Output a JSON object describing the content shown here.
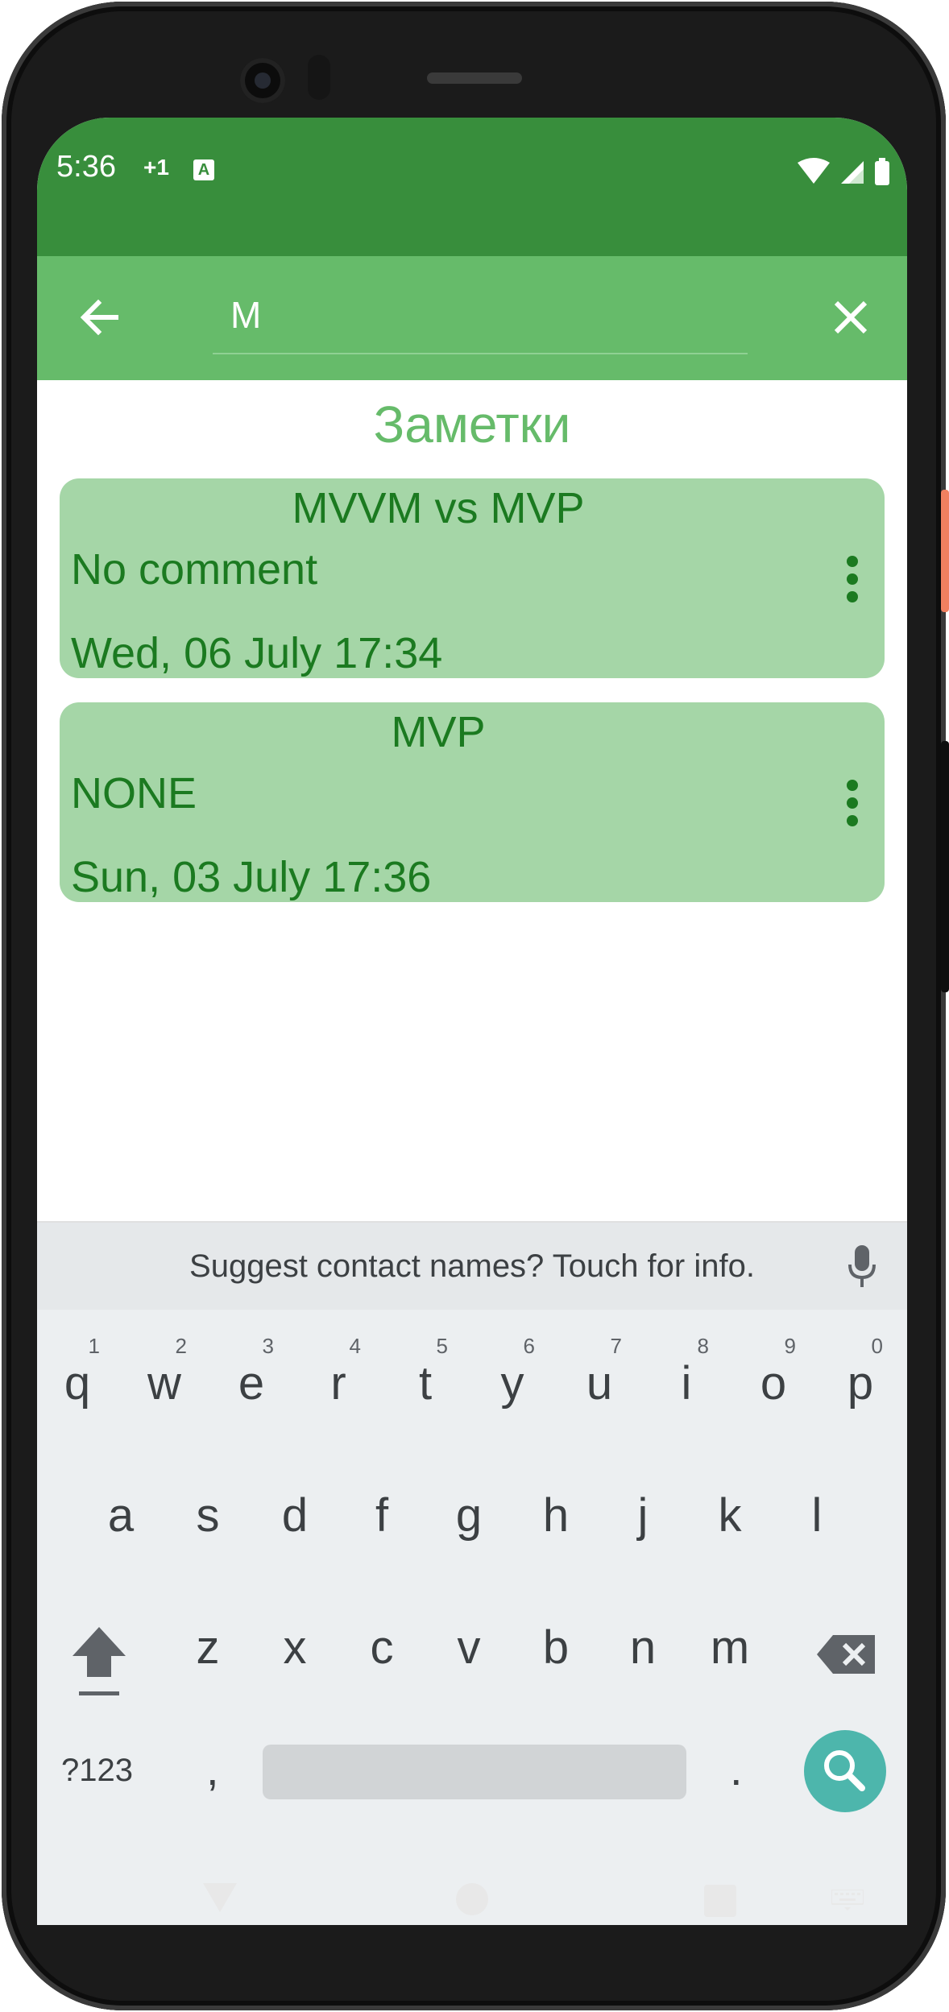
{
  "status_bar": {
    "time": "5:36",
    "extra": "+1",
    "badge": "A"
  },
  "toolbar": {
    "search_value": "M",
    "back_icon": "arrow-left-icon",
    "close_icon": "close-icon"
  },
  "page": {
    "title": "Заметки"
  },
  "notes": [
    {
      "title": "MVVM vs MVP",
      "comment": "No comment",
      "date": "Wed, 06 July  17:34"
    },
    {
      "title": "MVP",
      "comment": "NONE",
      "date": "Sun, 03 July  17:36"
    }
  ],
  "keyboard": {
    "suggestion": "Suggest contact names? Touch for info.",
    "row1": [
      {
        "ch": "q",
        "hint": "1"
      },
      {
        "ch": "w",
        "hint": "2"
      },
      {
        "ch": "e",
        "hint": "3"
      },
      {
        "ch": "r",
        "hint": "4"
      },
      {
        "ch": "t",
        "hint": "5"
      },
      {
        "ch": "y",
        "hint": "6"
      },
      {
        "ch": "u",
        "hint": "7"
      },
      {
        "ch": "i",
        "hint": "8"
      },
      {
        "ch": "o",
        "hint": "9"
      },
      {
        "ch": "p",
        "hint": "0"
      }
    ],
    "row2": [
      "a",
      "s",
      "d",
      "f",
      "g",
      "h",
      "j",
      "k",
      "l"
    ],
    "row3": [
      "z",
      "x",
      "c",
      "v",
      "b",
      "n",
      "m"
    ],
    "symbols_label": "?123",
    "comma": ",",
    "period": "."
  },
  "colors": {
    "status_bar": "#388e3c",
    "toolbar": "#66bb6a",
    "card": "#a5d6a7",
    "card_text": "#1b7a20",
    "search_key": "#4db6ac"
  }
}
